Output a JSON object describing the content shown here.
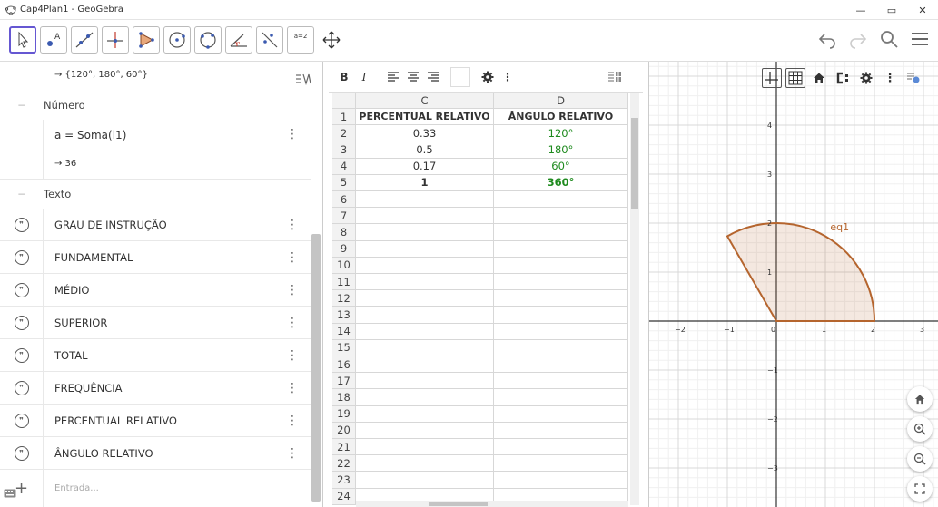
{
  "window": {
    "title": "Cap4Plan1 - GeoGebra",
    "controls": [
      "—",
      "▭",
      "✕"
    ]
  },
  "toolbar": {
    "tools": [
      "move-tool",
      "point-tool",
      "line-tool",
      "perpendicular-tool",
      "polygon-tool",
      "circle-tool",
      "circle-three-points-tool",
      "angle-tool",
      "reflect-tool",
      "slider-tool",
      "move-graphics-tool"
    ],
    "slider_label": "a=2",
    "right_icons": [
      "undo-icon",
      "redo-icon",
      "search-icon",
      "menu-icon"
    ]
  },
  "algebra": {
    "list_result": "→ {120°, 180°, 60°}",
    "sections": {
      "number": "Número",
      "text": "Texto"
    },
    "number_def": "a = Soma(l1)",
    "number_value": "→ 36",
    "text_items": [
      "GRAU DE INSTRUÇÃO",
      "FUNDAMENTAL",
      "MÉDIO",
      "SUPERIOR",
      "TOTAL",
      "FREQUÊNCIA",
      "PERCENTUAL RELATIVO",
      "ÂNGULO RELATIVO"
    ],
    "input_placeholder": "Entrada..."
  },
  "spreadsheet": {
    "toolbar": {
      "bold": "B",
      "italic": "I",
      "more": "⋮"
    },
    "columns": [
      "C",
      "D"
    ],
    "rows": [
      "1",
      "2",
      "3",
      "4",
      "5",
      "6",
      "7",
      "8",
      "9",
      "10",
      "11",
      "12",
      "13",
      "14",
      "15",
      "16",
      "17",
      "18",
      "19",
      "20",
      "21",
      "22",
      "23",
      "24"
    ],
    "cells": [
      [
        "PERCENTUAL RELATIVO",
        "ÂNGULO RELATIVO"
      ],
      [
        "0.33",
        "120°"
      ],
      [
        "0.5",
        "180°"
      ],
      [
        "0.17",
        "60°"
      ],
      [
        "1",
        "360°"
      ]
    ],
    "angle_color": "#1e8a1e"
  },
  "graphics": {
    "x_ticks": [
      "−2",
      "−1",
      "0",
      "1",
      "2",
      "3"
    ],
    "y_ticks": [
      "4",
      "3",
      "2",
      "1",
      "−1",
      "−2",
      "−3"
    ],
    "curve_label": "eq1",
    "sector_color": "#b5652e",
    "toolbar_icons": [
      "axes-icon",
      "grid-icon",
      "home-icon",
      "point-capture-icon",
      "settings-icon",
      "more-icon",
      "style-bar-toggle-icon"
    ],
    "side_buttons": [
      "home-icon",
      "zoom-in-icon",
      "zoom-out-icon",
      "fullscreen-icon"
    ]
  }
}
